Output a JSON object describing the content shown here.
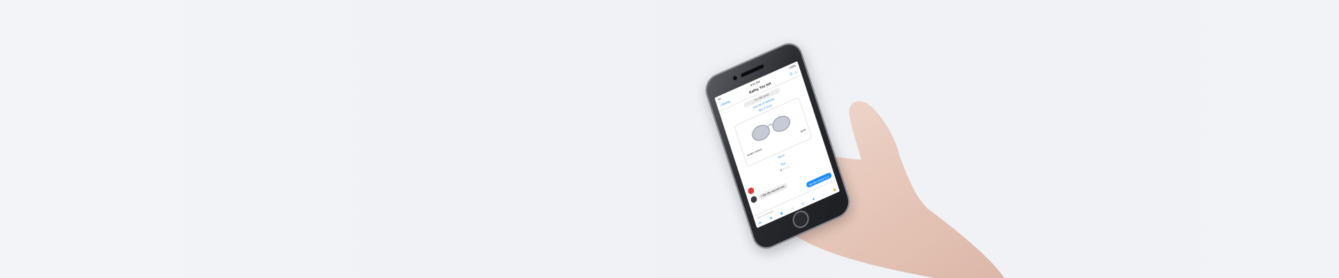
{
  "scene": {
    "background_color": "#f1f3f6",
    "description_subject": "hand-holding-phone"
  },
  "phone": {
    "status_bar": {
      "left": "•••",
      "time": "9:41 AM",
      "right": "100%"
    },
    "nav": {
      "back_label": "Home",
      "title": "Kathy, You bet",
      "icons": [
        "phone-icon",
        "info-icon"
      ]
    },
    "chip_text": "For 365 views",
    "see_results_link": "See All 10 Results",
    "see_all_link": "See 2 more",
    "product": {
      "name": "Aviator Classic",
      "price": "$155",
      "side_price_left": "$180",
      "side_price_right": "$ 88"
    },
    "tap_label": "Tap to",
    "buy_label": "Buy",
    "messages": [
      {
        "from": "bot",
        "text": ""
      },
      {
        "from": "user",
        "text": "I like the second one"
      },
      {
        "from": "me",
        "text": "Me like those to 1"
      }
    ],
    "composer": {
      "placeholder": "Type a message...",
      "icons": [
        "aa-icon",
        "camera-icon",
        "image-icon",
        "sticker-icon",
        "gif-icon",
        "emoji-icon",
        "mic-icon",
        "like-icon"
      ]
    },
    "accent_color": "#1a8cff"
  }
}
